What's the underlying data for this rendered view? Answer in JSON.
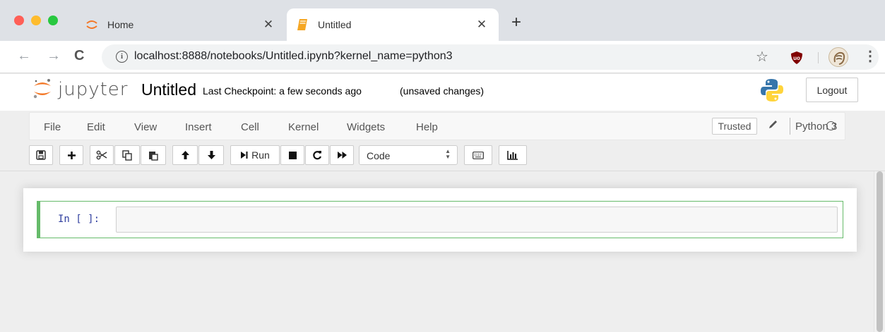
{
  "browser": {
    "tabs": [
      {
        "title": "Home",
        "close": "✕"
      },
      {
        "title": "Untitled",
        "close": "✕"
      }
    ],
    "new_tab": "+",
    "nav": {
      "back": "←",
      "forward": "→",
      "reload": "C"
    },
    "address": {
      "info": "i",
      "url": "localhost:8888/notebooks/Untitled.ipynb?kernel_name=python3"
    },
    "star": "☆",
    "menu": "⋮"
  },
  "jupyter": {
    "logo_text": "jupyter",
    "notebook_title": "Untitled",
    "checkpoint": "Last Checkpoint: a few seconds ago",
    "unsaved": "(unsaved changes)",
    "logout": "Logout"
  },
  "menubar": {
    "items": [
      "File",
      "Edit",
      "View",
      "Insert",
      "Cell",
      "Kernel",
      "Widgets",
      "Help"
    ],
    "trusted": "Trusted",
    "kernel_name": "Python 3"
  },
  "toolbar": {
    "run_label": "Run",
    "cell_type": "Code",
    "cell_type_options": [
      "Code"
    ]
  },
  "cell": {
    "prompt": "In [ ]:",
    "source": ""
  },
  "colors": {
    "tabstrip": "#dee1e6",
    "jupyter_orange": "#f37726",
    "cell_border_green": "#66bb6a",
    "prompt_blue": "#303f9f"
  },
  "icons": [
    "save-icon",
    "plus-icon",
    "scissors-icon",
    "copy-icon",
    "paste-icon",
    "arrow-up-icon",
    "arrow-down-icon",
    "step-forward-icon",
    "stop-icon",
    "restart-icon",
    "fast-forward-icon",
    "keyboard-icon",
    "bar-chart-icon",
    "pencil-icon",
    "kernel-idle-icon",
    "python-logo-icon",
    "ublock-icon"
  ]
}
